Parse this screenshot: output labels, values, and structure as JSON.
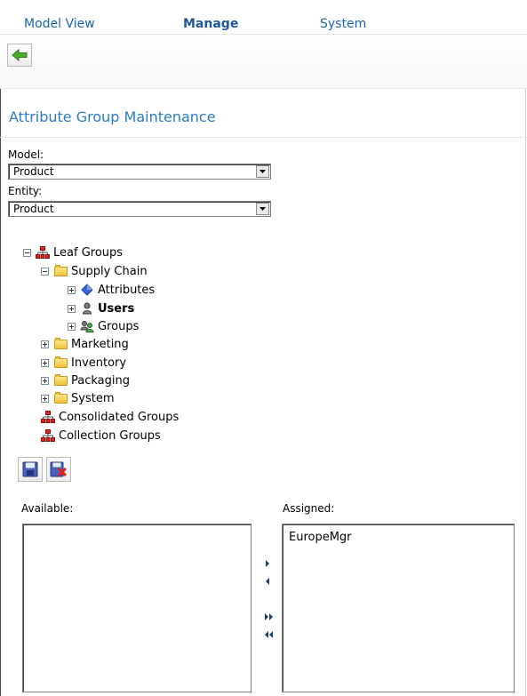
{
  "nav": {
    "tabs": [
      {
        "label": "Model View"
      },
      {
        "label": "Manage"
      },
      {
        "label": "System"
      }
    ]
  },
  "page": {
    "title": "Attribute Group Maintenance"
  },
  "form": {
    "model_label": "Model:",
    "model_value": "Product",
    "entity_label": "Entity:",
    "entity_value": "Product"
  },
  "tree": {
    "leaf_groups": "Leaf Groups",
    "supply_chain": "Supply Chain",
    "attributes": "Attributes",
    "users": "Users",
    "groups": "Groups",
    "marketing": "Marketing",
    "inventory": "Inventory",
    "packaging": "Packaging",
    "system": "System",
    "consolidated_groups": "Consolidated Groups",
    "collection_groups": "Collection Groups"
  },
  "assign": {
    "available_label": "Available:",
    "assigned_label": "Assigned:",
    "available_items": [],
    "assigned_items": [
      "EuropeMgr"
    ]
  },
  "icons": {
    "back": "arrow-left-icon",
    "save": "save-icon",
    "cancel": "cancel-save-icon",
    "hierarchy": "hierarchy-icon",
    "folder": "folder-icon",
    "attributes": "diamond-icon",
    "users": "user-icon",
    "groups": "group-icon"
  },
  "colors": {
    "accent": "#2b7bc4",
    "nav_text": "#1a66b3",
    "back_arrow": "#3a9e27"
  }
}
